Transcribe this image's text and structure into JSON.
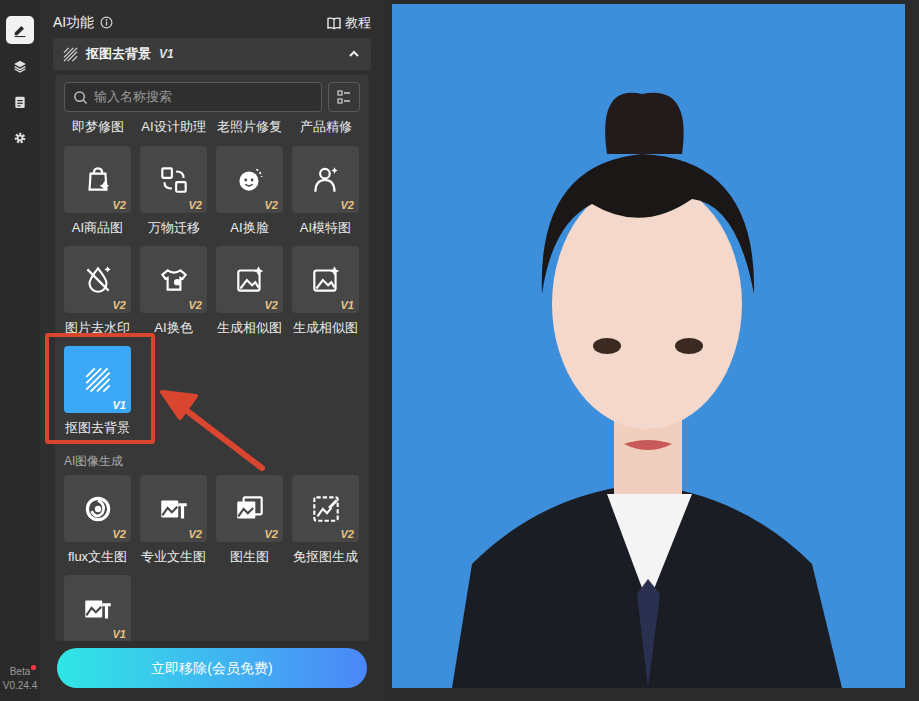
{
  "rail": {
    "items": [
      {
        "selected": true
      },
      {
        "selected": false
      },
      {
        "selected": false
      },
      {
        "selected": false
      }
    ],
    "beta": "Beta",
    "version": "V0.24.4"
  },
  "panel": {
    "title": "AI功能",
    "tutorial": "教程"
  },
  "dropdown": {
    "label": "抠图去背景",
    "badge": "V1",
    "expanded": true
  },
  "search": {
    "placeholder": "输入名称搜索"
  },
  "partial_labels": [
    "即梦修图",
    "AI设计助理",
    "老照片修复",
    "产品精修"
  ],
  "sections": [
    {
      "title": "",
      "tools": [
        {
          "label": "AI商品图",
          "badge": "V2",
          "selected": false
        },
        {
          "label": "万物迁移",
          "badge": "V2",
          "selected": false
        },
        {
          "label": "AI换脸",
          "badge": "V2",
          "selected": false
        },
        {
          "label": "AI模特图",
          "badge": "V2",
          "selected": false
        },
        {
          "label": "图片去水印",
          "badge": "V2",
          "selected": false
        },
        {
          "label": "AI换色",
          "badge": "V2",
          "selected": false
        },
        {
          "label": "生成相似图",
          "badge": "V2",
          "selected": false
        },
        {
          "label": "生成相似图",
          "badge": "V1",
          "selected": false
        },
        {
          "label": "抠图去背景",
          "badge": "V1",
          "selected": true
        }
      ]
    },
    {
      "title": "AI图像生成",
      "tools": [
        {
          "label": "flux文生图",
          "badge": "V2",
          "selected": false
        },
        {
          "label": "专业文生图",
          "badge": "V2",
          "selected": false
        },
        {
          "label": "图生图",
          "badge": "V2",
          "selected": false
        },
        {
          "label": "免抠图生成",
          "badge": "V2",
          "selected": false
        },
        {
          "label": "",
          "badge": "V1",
          "selected": false
        }
      ]
    }
  ],
  "action_button": "立即移除(会员免费)"
}
